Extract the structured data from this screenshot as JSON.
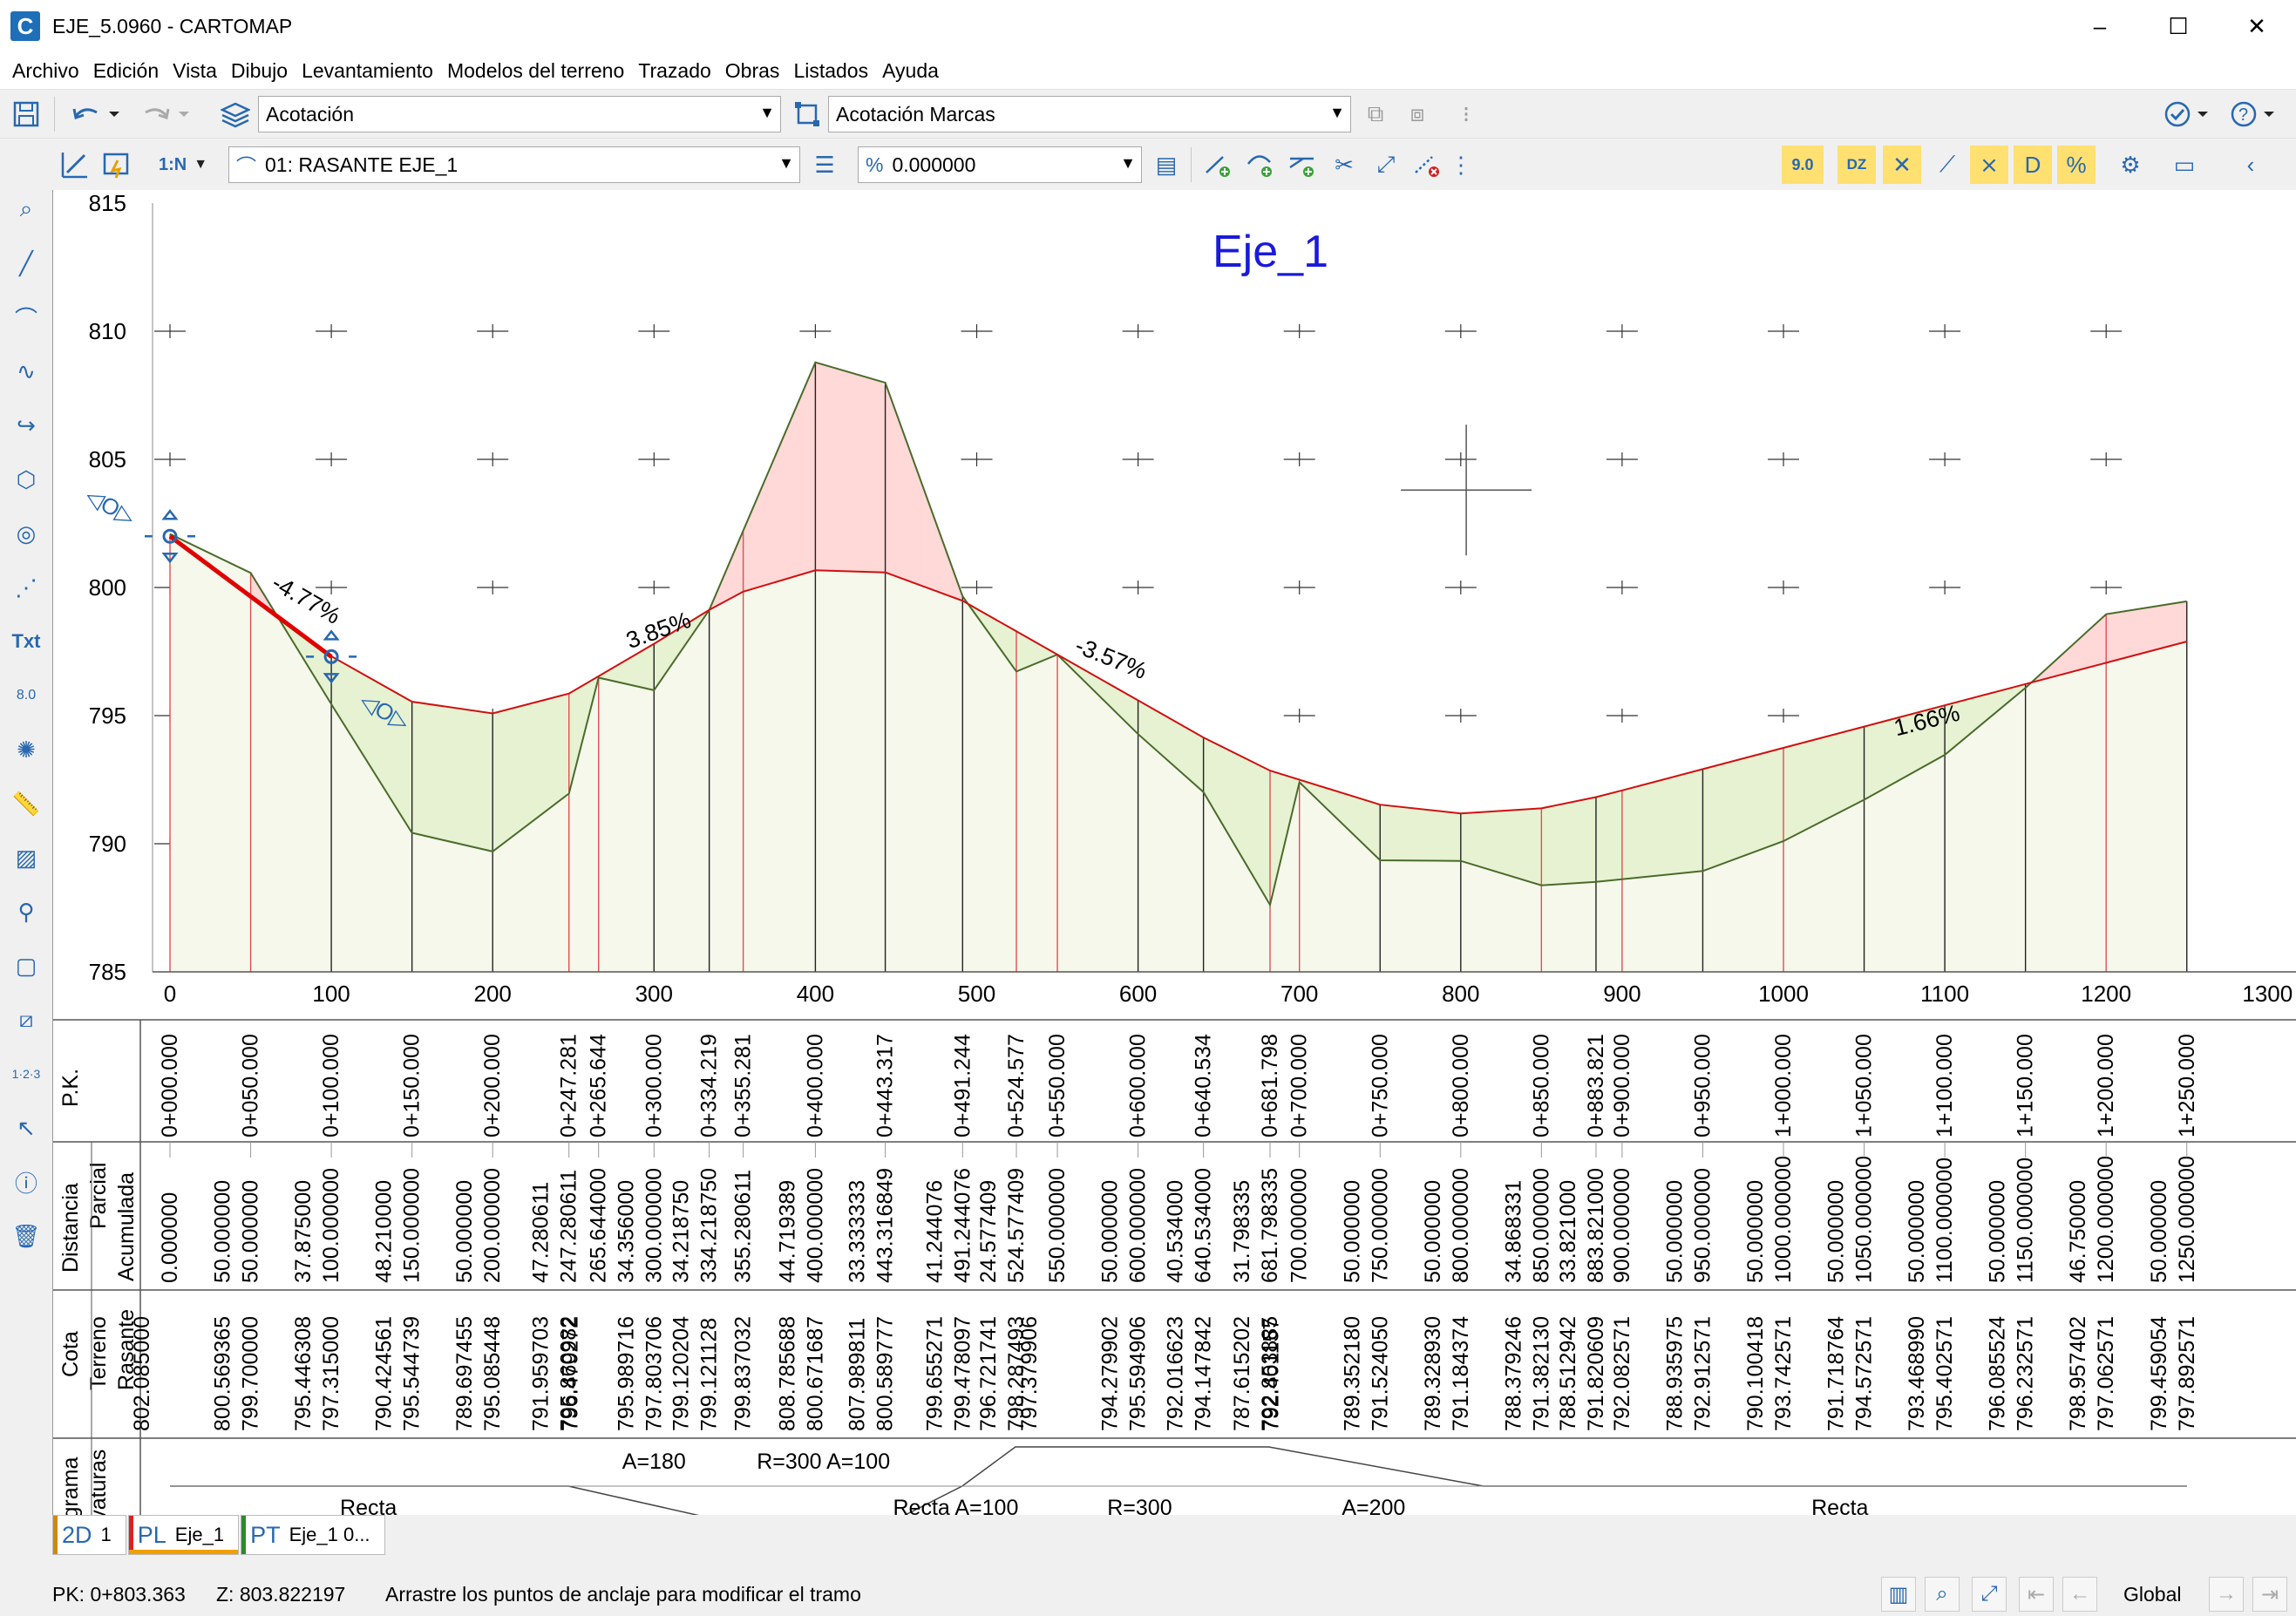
{
  "window": {
    "app_icon": "C",
    "title": "EJE_5.0960 - CARTOMAP",
    "controls": [
      "–",
      "☐",
      "✕"
    ]
  },
  "menu": [
    "Archivo",
    "Edición",
    "Vista",
    "Dibujo",
    "Levantamiento",
    "Modelos del terreno",
    "Trazado",
    "Obras",
    "Listados",
    "Ayuda"
  ],
  "toolbar1": {
    "layer_combo": "Acotación",
    "marks_combo": "Acotación Marcas"
  },
  "toolbar2": {
    "scale_label": "1:N",
    "rasante_combo": "01: RASANTE EJE_1",
    "slope_combo": "0.000000",
    "elev_button": "9.0",
    "dz_label": "DZ"
  },
  "profile": {
    "title": "Eje_1",
    "y_ticks": [
      "815",
      "810",
      "805",
      "800",
      "795",
      "790",
      "785"
    ],
    "x_ticks": [
      "0",
      "100",
      "200",
      "300",
      "400",
      "500",
      "600",
      "700",
      "800",
      "900",
      "1000",
      "1100",
      "1200",
      "1300"
    ],
    "slopes": [
      "-4.77%",
      "3.85%",
      "-3.57%",
      "1.66%"
    ],
    "colors": {
      "terrain": "#4a6b2a",
      "rasante": "#d01010",
      "cut_fill": "#ffd8d8",
      "embank_fill": "#e6f2d2",
      "title": "#1a1adc"
    }
  },
  "guitar": {
    "row_labels": {
      "pk": "P.K.",
      "distancia": "Distancia",
      "parcial": "Parcial",
      "acumulada": "Acumulada",
      "cota": "Cota",
      "terreno": "Terreno",
      "rasante": "Rasante",
      "diagrama": "Diagrama",
      "curvaturas": "Curvaturas"
    },
    "columns": [
      {
        "pk": "0+000.000",
        "parcial": "",
        "acumulada": "0.000000",
        "terreno": "802.085000",
        "rasante": ""
      },
      {
        "pk": "0+050.000",
        "parcial": "50.000000",
        "acumulada": "50.000000",
        "terreno": "800.569365",
        "rasante": "799.700000"
      },
      {
        "pk": "0+100.000",
        "parcial": "37.875000",
        "acumulada": "100.000000",
        "terreno": "795.446308",
        "rasante": "797.315000"
      },
      {
        "pk": "0+150.000",
        "parcial": "48.210000",
        "acumulada": "150.000000",
        "terreno": "790.424561",
        "rasante": "795.544739"
      },
      {
        "pk": "0+200.000",
        "parcial": "50.000000",
        "acumulada": "200.000000",
        "terreno": "789.697455",
        "rasante": "795.085448"
      },
      {
        "pk": "0+247.281",
        "parcial": "47.280611",
        "acumulada": "247.280611",
        "terreno": "791.959703",
        "rasante": "795.860982"
      },
      {
        "pk": "0+265.644",
        "parcial": "",
        "acumulada": "265.644000",
        "terreno": "796.479272",
        "rasante": ""
      },
      {
        "pk": "0+300.000",
        "parcial": "34.356000",
        "acumulada": "300.000000",
        "terreno": "795.989716",
        "rasante": "797.803706"
      },
      {
        "pk": "0+334.219",
        "parcial": "34.218750",
        "acumulada": "334.218750",
        "terreno": "799.120204",
        "rasante": "799.121128"
      },
      {
        "pk": "0+355.281",
        "parcial": "",
        "acumulada": "355.280611",
        "terreno": "",
        "rasante": "799.837032"
      },
      {
        "pk": "0+400.000",
        "parcial": "44.719389",
        "acumulada": "400.000000",
        "terreno": "808.785688",
        "rasante": "800.671687"
      },
      {
        "pk": "0+443.317",
        "parcial": "33.333333",
        "acumulada": "443.316849",
        "terreno": "807.989811",
        "rasante": "800.589777"
      },
      {
        "pk": "0+491.244",
        "parcial": "41.244076",
        "acumulada": "491.244076",
        "terreno": "799.655271",
        "rasante": "799.478097"
      },
      {
        "pk": "0+524.577",
        "parcial": "24.577409",
        "acumulada": "524.577409",
        "terreno": "796.721741",
        "rasante": "798.287493"
      },
      {
        "pk": "0+550.000",
        "parcial": "",
        "acumulada": "550.000000",
        "terreno": "797.379906",
        "rasante": ""
      },
      {
        "pk": "0+600.000",
        "parcial": "50.000000",
        "acumulada": "600.000000",
        "terreno": "794.279902",
        "rasante": "795.594906"
      },
      {
        "pk": "0+640.534",
        "parcial": "40.534000",
        "acumulada": "640.534000",
        "terreno": "792.016623",
        "rasante": "794.147842"
      },
      {
        "pk": "0+681.798",
        "parcial": "31.798335",
        "acumulada": "681.798335",
        "terreno": "787.615202",
        "rasante": "792.853885"
      },
      {
        "pk": "0+700.000",
        "parcial": "",
        "acumulada": "700.000000",
        "terreno": "792.401157",
        "rasante": ""
      },
      {
        "pk": "0+750.000",
        "parcial": "50.000000",
        "acumulada": "750.000000",
        "terreno": "789.352180",
        "rasante": "791.524050"
      },
      {
        "pk": "0+800.000",
        "parcial": "50.000000",
        "acumulada": "800.000000",
        "terreno": "789.328930",
        "rasante": "791.184374"
      },
      {
        "pk": "0+850.000",
        "parcial": "34.868331",
        "acumulada": "850.000000",
        "terreno": "788.379246",
        "rasante": "791.382130"
      },
      {
        "pk": "0+883.821",
        "parcial": "33.821000",
        "acumulada": "883.821000",
        "terreno": "788.512942",
        "rasante": "791.820609"
      },
      {
        "pk": "0+900.000",
        "parcial": "",
        "acumulada": "900.000000",
        "terreno": "",
        "rasante": "792.082571"
      },
      {
        "pk": "0+950.000",
        "parcial": "50.000000",
        "acumulada": "950.000000",
        "terreno": "788.935975",
        "rasante": "792.912571"
      },
      {
        "pk": "1+000.000",
        "parcial": "50.000000",
        "acumulada": "1000.000000",
        "terreno": "790.100418",
        "rasante": "793.742571"
      },
      {
        "pk": "1+050.000",
        "parcial": "50.000000",
        "acumulada": "1050.000000",
        "terreno": "791.718764",
        "rasante": "794.572571"
      },
      {
        "pk": "1+100.000",
        "parcial": "50.000000",
        "acumulada": "1100.000000",
        "terreno": "793.468990",
        "rasante": "795.402571"
      },
      {
        "pk": "1+150.000",
        "parcial": "50.000000",
        "acumulada": "1150.000000",
        "terreno": "796.085524",
        "rasante": "796.232571"
      },
      {
        "pk": "1+200.000",
        "parcial": "46.750000",
        "acumulada": "1200.000000",
        "terreno": "798.957402",
        "rasante": "797.062571"
      },
      {
        "pk": "1+250.000",
        "parcial": "50.000000",
        "acumulada": "1250.000000",
        "terreno": "799.459054",
        "rasante": "797.892571"
      }
    ],
    "curvature_labels_top": [
      "A=180",
      "R=300 A=100"
    ],
    "curvature_labels_bottom": [
      "Recta",
      "Recta A=100",
      "R=300",
      "A=200",
      "Recta"
    ]
  },
  "tabs": [
    {
      "kind": "2D",
      "label": "1",
      "color": "#d08a00",
      "active": false
    },
    {
      "kind": "PL",
      "label": "Eje_1",
      "color": "#e02020",
      "active": true
    },
    {
      "kind": "PT",
      "label": "Eje_1 0...",
      "color": "#2a8a2a",
      "active": false
    }
  ],
  "status": {
    "pk": "PK:  0+803.363",
    "z": "Z:  803.822197",
    "hint": "Arrastre los puntos de anclaje para modificar el tramo",
    "scope": "Global"
  }
}
